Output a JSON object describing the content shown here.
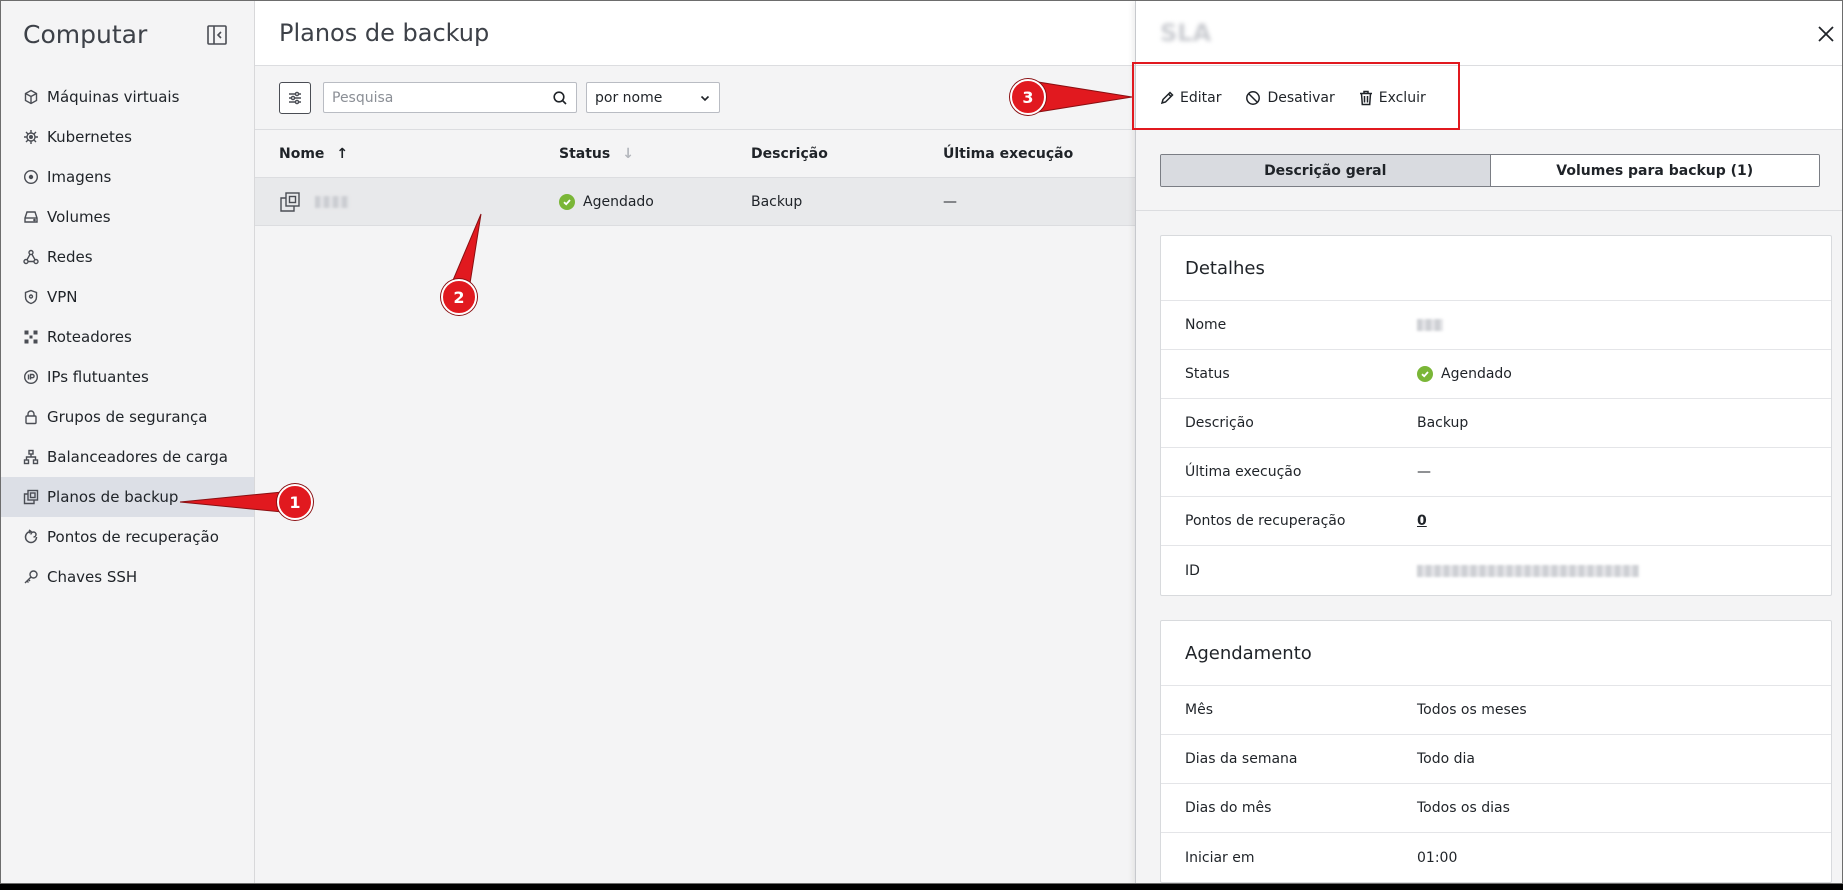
{
  "sidebar": {
    "title": "Computar",
    "items": [
      {
        "label": "Máquinas virtuais",
        "icon": "cube-icon"
      },
      {
        "label": "Kubernetes",
        "icon": "helm-wheel-icon"
      },
      {
        "label": "Imagens",
        "icon": "disc-icon"
      },
      {
        "label": "Volumes",
        "icon": "drive-icon"
      },
      {
        "label": "Redes",
        "icon": "network-icon"
      },
      {
        "label": "VPN",
        "icon": "shield-icon"
      },
      {
        "label": "Roteadores",
        "icon": "router-icon"
      },
      {
        "label": "IPs flutuantes",
        "icon": "floating-ip-icon"
      },
      {
        "label": "Grupos de segurança",
        "icon": "lock-icon"
      },
      {
        "label": "Balanceadores de carga",
        "icon": "load-balancer-icon"
      },
      {
        "label": "Planos de backup",
        "icon": "backup-plans-icon",
        "active": true
      },
      {
        "label": "Pontos de recuperação",
        "icon": "recovery-icon"
      },
      {
        "label": "Chaves SSH",
        "icon": "key-icon"
      }
    ]
  },
  "main": {
    "title": "Planos de backup",
    "search_placeholder": "Pesquisa",
    "sort_select": "por nome",
    "columns": {
      "name": "Nome",
      "status": "Status",
      "description": "Descrição",
      "last_run": "Última execução"
    },
    "rows": [
      {
        "name": "",
        "status": "Agendado",
        "description": "Backup",
        "last_run": "—"
      }
    ]
  },
  "panel": {
    "title": "SLA",
    "actions": {
      "edit": "Editar",
      "disable": "Desativar",
      "delete": "Excluir"
    },
    "tabs": [
      "Descrição geral",
      "Volumes para backup (1)"
    ],
    "details": {
      "title": "Detalhes",
      "rows": [
        {
          "key": "Nome",
          "value": ""
        },
        {
          "key": "Status",
          "value": "Agendado"
        },
        {
          "key": "Descrição",
          "value": "Backup"
        },
        {
          "key": "Última execução",
          "value": "—"
        },
        {
          "key": "Pontos de recuperação",
          "value": "0"
        },
        {
          "key": "ID",
          "value": ""
        }
      ]
    },
    "schedule": {
      "title": "Agendamento",
      "rows": [
        {
          "key": "Mês",
          "value": "Todos os meses"
        },
        {
          "key": "Dias da semana",
          "value": "Todo dia"
        },
        {
          "key": "Dias do mês",
          "value": "Todos os dias"
        },
        {
          "key": "Iniciar em",
          "value": "01:00"
        }
      ]
    }
  },
  "annotations": {
    "badge1": "1",
    "badge2": "2",
    "badge3": "3"
  },
  "colors": {
    "annotation_red": "#e1191f",
    "status_green": "#7ab637",
    "link_blue": "#2c5aa0"
  }
}
